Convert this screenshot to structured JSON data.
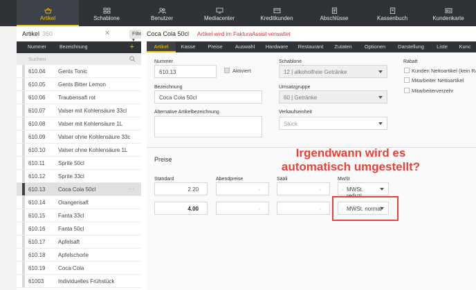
{
  "nav": {
    "items": [
      {
        "label": "Artikel",
        "icon": "basket-icon",
        "active": true
      },
      {
        "label": "Schablone",
        "icon": "grid-icon",
        "active": false
      },
      {
        "label": "Benutzer",
        "icon": "users-icon",
        "active": false
      },
      {
        "label": "Mediacenter",
        "icon": "monitor-icon",
        "active": false
      },
      {
        "label": "Kreditkunden",
        "icon": "card-icon",
        "active": false
      },
      {
        "label": "Abschlüsse",
        "icon": "report-icon",
        "active": false
      },
      {
        "label": "Kassenbuch",
        "icon": "book-icon",
        "active": false
      },
      {
        "label": "Kundenkarte",
        "icon": "customer-card-icon",
        "active": false
      }
    ]
  },
  "left": {
    "title": "Artikel",
    "count": "360",
    "filter_label": "Filter",
    "col_number": "Nummer",
    "col_name": "Bezeichnung",
    "search_placeholder": "Suchen",
    "rows": [
      {
        "num": "610.04",
        "name": "Gents Tonic"
      },
      {
        "num": "610.05",
        "name": "Gents Bitter Lemon"
      },
      {
        "num": "610.06",
        "name": "Traubensaft rot"
      },
      {
        "num": "610.07",
        "name": "Valser mit Kohlensäure 33cl"
      },
      {
        "num": "610.08",
        "name": "Valser mit Kohlensäure 1L"
      },
      {
        "num": "610.09",
        "name": "Valser ohne Kohlensäure 33c"
      },
      {
        "num": "610.10",
        "name": "Valser ohne Kohlensäure 1L"
      },
      {
        "num": "610.11",
        "name": "Sprite 50cl"
      },
      {
        "num": "610.12",
        "name": "Sprite 33cl"
      },
      {
        "num": "610.13",
        "name": "Coca Cola 50cl",
        "selected": true
      },
      {
        "num": "610.14",
        "name": "Orangensaft"
      },
      {
        "num": "610.15",
        "name": "Fanta 33cl"
      },
      {
        "num": "610.16",
        "name": "Fanta 50cl"
      },
      {
        "num": "610.17",
        "name": "Apfelsaft"
      },
      {
        "num": "610.18",
        "name": "Apfelschorle"
      },
      {
        "num": "610.19",
        "name": "Coca Cola"
      },
      {
        "num": "61003",
        "name": "Individuelles Frühstück"
      }
    ]
  },
  "detail": {
    "title": "Coca Cola 50cl",
    "notice": "Artikel wird im FakturaAssist verwaltet",
    "tabs": [
      "Artikel",
      "Kasse",
      "Preise",
      "Auswahl",
      "Hardware",
      "Restaurant",
      "Zutaten",
      "Optionen",
      "Darstellung",
      "Liste",
      "Kunc"
    ],
    "form": {
      "nummer_label": "Nummer",
      "nummer_value": "610.13",
      "aktiviert_label": "Aktiviert",
      "schablone_label": "Schablone",
      "schablone_value": "12 | alkoholfreie Getränke",
      "rabatt_label": "Rabatt",
      "rabatt_options": [
        "Kunden Nettoartikel (kein Ra",
        "Mitarbeiter Nettoartikel",
        "Mitarbeiterverzehr"
      ],
      "bezeichnung_label": "Bezeichnung",
      "bezeichnung_value": "Coca Cola 50cl",
      "umsatz_label": "Umsatzgruppe",
      "umsatz_value": "60 | Getränke",
      "alt_label": "Alternative Artikelbezeichnung",
      "verkauf_label": "Verkaufseinheit",
      "verkauf_value": "Stück"
    },
    "preise": {
      "section_title": "Preise",
      "col_standard": "Standard",
      "col_abend": "Abendpreise",
      "col_saeli": "Sääli",
      "col_mwst": "MwSt",
      "row1": {
        "standard": "2.20",
        "mwst": "MWSt. reduzi..."
      },
      "row2": {
        "standard": "4.00",
        "mwst": "MWSt. normal"
      },
      "dash": "-"
    },
    "annotation": "Irgendwann wird es automatisch umgestellt?"
  },
  "colors": {
    "accent": "#f1c40f",
    "nav_bg": "#2f3338",
    "annotation": "#e8413a",
    "notice": "#d9343a"
  }
}
